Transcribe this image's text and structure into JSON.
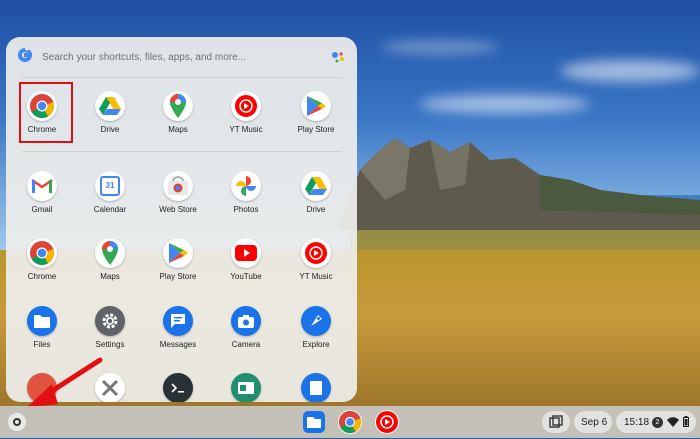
{
  "search": {
    "placeholder": "Search your shortcuts, files, apps, and more..."
  },
  "apps_row1": [
    {
      "label": "Chrome",
      "icon": "chrome-icon"
    },
    {
      "label": "Drive",
      "icon": "drive-icon"
    },
    {
      "label": "Maps",
      "icon": "maps-icon"
    },
    {
      "label": "YT Music",
      "icon": "yt-music-icon"
    },
    {
      "label": "Play Store",
      "icon": "play-store-icon"
    }
  ],
  "apps_grid": [
    {
      "label": "Gmail",
      "icon": "gmail-icon"
    },
    {
      "label": "Calendar",
      "icon": "calendar-icon",
      "badge": "31"
    },
    {
      "label": "Web Store",
      "icon": "web-store-icon"
    },
    {
      "label": "Photos",
      "icon": "photos-icon"
    },
    {
      "label": "Drive",
      "icon": "drive-icon"
    },
    {
      "label": "Chrome",
      "icon": "chrome-icon"
    },
    {
      "label": "Maps",
      "icon": "maps-icon"
    },
    {
      "label": "Play Store",
      "icon": "play-store-icon"
    },
    {
      "label": "YouTube",
      "icon": "youtube-icon"
    },
    {
      "label": "YT Music",
      "icon": "yt-music-icon"
    },
    {
      "label": "Files",
      "icon": "files-icon"
    },
    {
      "label": "Settings",
      "icon": "settings-icon"
    },
    {
      "label": "Messages",
      "icon": "messages-icon"
    },
    {
      "label": "Camera",
      "icon": "camera-icon"
    },
    {
      "label": "Explore",
      "icon": "explore-icon"
    }
  ],
  "shelf": {
    "pinned": [
      "files-icon",
      "chrome-icon",
      "yt-music-icon"
    ],
    "date": "Sep 6",
    "time": "15:18",
    "notification_count": "2"
  },
  "colors": {
    "highlight": "#e01010",
    "annotation_arrow": "#e01010"
  }
}
